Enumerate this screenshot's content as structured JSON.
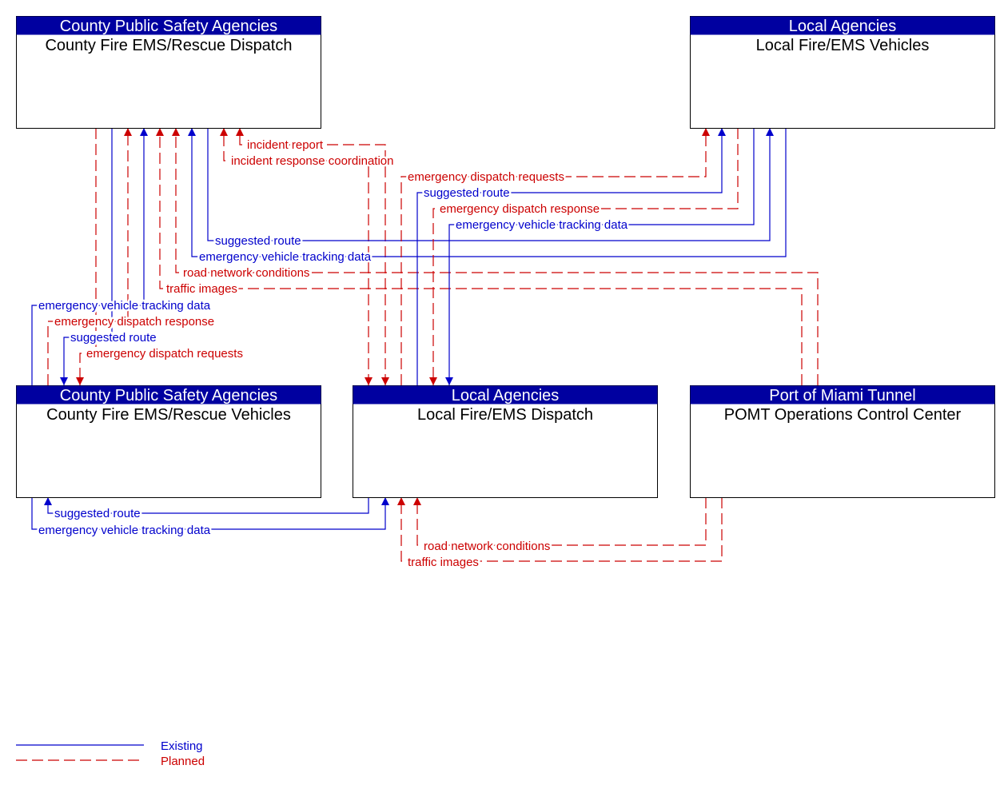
{
  "boxes": [
    {
      "group": "County Public Safety Agencies",
      "name": "County Fire EMS/Rescue Dispatch"
    },
    {
      "group": "Local Agencies",
      "name": "Local Fire/EMS Vehicles"
    },
    {
      "group": "County Public Safety Agencies",
      "name": "County Fire EMS/Rescue Vehicles"
    },
    {
      "group": "Local Agencies",
      "name": "Local Fire/EMS Dispatch"
    },
    {
      "group": "Port of Miami Tunnel",
      "name": "POMT Operations Control Center"
    }
  ],
  "flows": [
    {
      "label": "incident report",
      "status": "planned"
    },
    {
      "label": "incident response coordination",
      "status": "planned"
    },
    {
      "label": "emergency vehicle tracking data",
      "status": "existing"
    },
    {
      "label": "emergency dispatch response",
      "status": "planned"
    },
    {
      "label": "suggested route",
      "status": "existing"
    },
    {
      "label": "emergency dispatch requests",
      "status": "planned"
    },
    {
      "label": "emergency vehicle tracking data",
      "status": "existing"
    },
    {
      "label": "suggested route",
      "status": "existing"
    },
    {
      "label": "road network conditions",
      "status": "planned"
    },
    {
      "label": "traffic images",
      "status": "planned"
    },
    {
      "label": "emergency dispatch requests",
      "status": "planned"
    },
    {
      "label": "suggested route",
      "status": "existing"
    },
    {
      "label": "emergency dispatch response",
      "status": "planned"
    },
    {
      "label": "emergency vehicle tracking data",
      "status": "existing"
    },
    {
      "label": "suggested route",
      "status": "existing"
    },
    {
      "label": "emergency vehicle tracking data",
      "status": "existing"
    },
    {
      "label": "road network conditions",
      "status": "planned"
    },
    {
      "label": "traffic images",
      "status": "planned"
    }
  ],
  "legend": {
    "existing": "Existing",
    "planned": "Planned"
  },
  "colors": {
    "existing": "#0000cc",
    "planned": "#cc0000",
    "header": "#0000a0"
  }
}
